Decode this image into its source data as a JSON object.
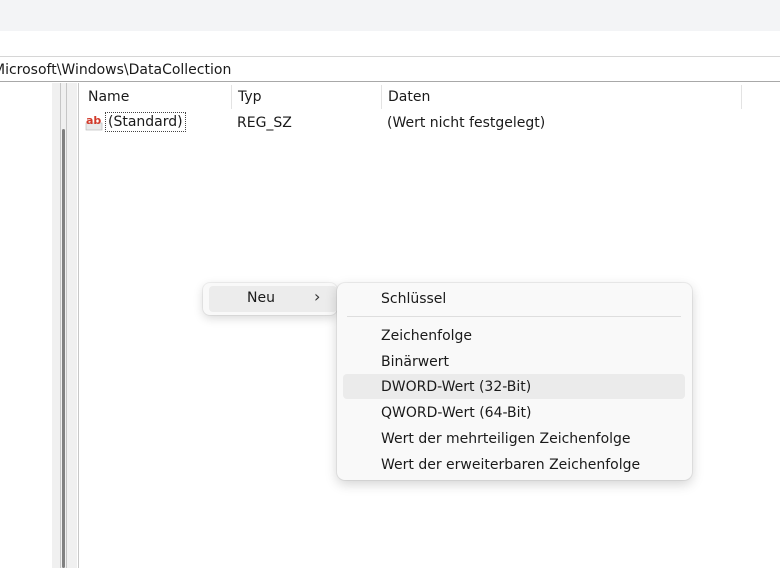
{
  "address_bar": {
    "path": "Microsoft\\Windows\\DataCollection"
  },
  "list": {
    "columns": [
      {
        "label": "Name"
      },
      {
        "label": "Typ"
      },
      {
        "label": "Daten"
      }
    ],
    "rows": [
      {
        "name": "(Standard)",
        "type": "REG_SZ",
        "data": "(Wert nicht festgelegt)",
        "icon": "string-value-icon"
      }
    ]
  },
  "context_menu": {
    "parent_item": {
      "label": "Neu",
      "arrow": "›"
    },
    "submenu": {
      "items": [
        {
          "label": "Schlüssel"
        },
        {
          "label": "Zeichenfolge"
        },
        {
          "label": "Binärwert"
        },
        {
          "label": "DWORD-Wert (32-Bit)",
          "hovered": true
        },
        {
          "label": "QWORD-Wert (64-Bit)"
        },
        {
          "label": "Wert der mehrteiligen Zeichenfolge"
        },
        {
          "label": "Wert der erweiterbaren Zeichenfolge"
        }
      ]
    }
  },
  "colors": {
    "menu_bg": "#f9f9f9",
    "hover_bg": "#ebebeb",
    "icon_red": "#d23a2a"
  }
}
